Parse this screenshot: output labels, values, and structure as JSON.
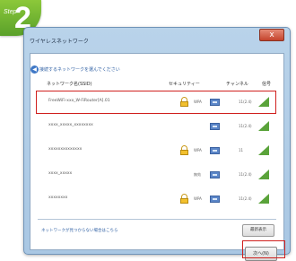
{
  "step": {
    "label": "Step",
    "number": "2"
  },
  "window": {
    "title": "ワイヤレスネットワーク",
    "close": "x",
    "instruction": "接続するネットワークを選んでください"
  },
  "table": {
    "headers": [
      "ネットワーク名(SSID)",
      "セキュリティー",
      "チャンネル",
      "信号"
    ],
    "rows": [
      {
        "name": "FreeWiFi-xxx_W-FiRouter[A].01",
        "secured": true,
        "auth": "WPA",
        "channel": "11(2.4)"
      },
      {
        "name": "xxxx_xxxxx_xxxxxxxx",
        "secured": false,
        "auth": "",
        "channel": "11(2.4)"
      },
      {
        "name": "xxxxxxxxxxxxxx",
        "secured": true,
        "auth": "WPA",
        "channel": "11"
      },
      {
        "name": "xxxx_xxxxx",
        "secured": false,
        "auth": "無効",
        "channel": "11(2.4)"
      },
      {
        "name": "xxxxxxxx",
        "secured": true,
        "auth": "WPA",
        "channel": "11(2.4)"
      }
    ]
  },
  "bottom_link": "ネットワークが見つからない場合はこちら",
  "update_button": "最新表示",
  "next_button": "次へ(N)",
  "colors": {
    "accent_green": "#6fb331",
    "highlight_red": "#d0201e",
    "lock": "#f2c02e",
    "signal": "#5aa33a"
  }
}
